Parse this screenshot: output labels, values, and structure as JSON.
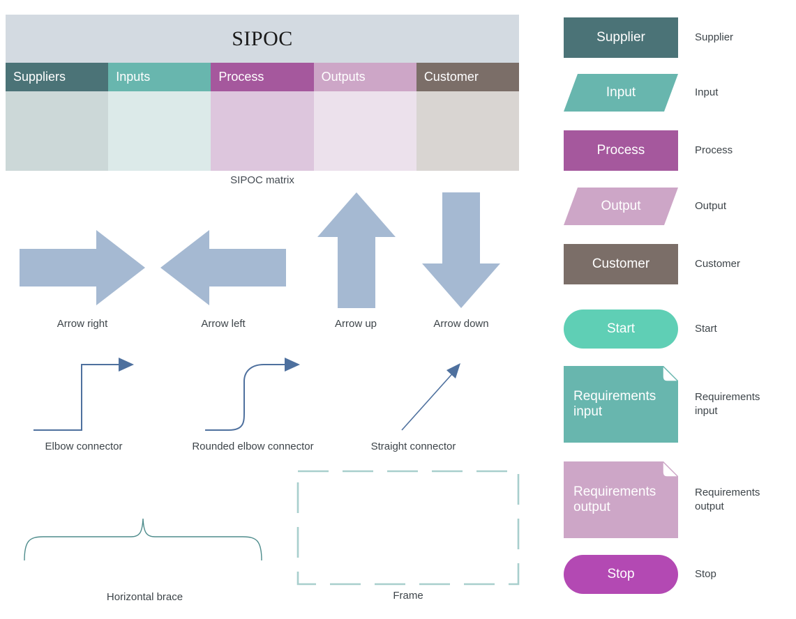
{
  "sipoc": {
    "title": "SIPOC",
    "caption": "SIPOC matrix",
    "title_band_color": "#d3dae1",
    "columns": [
      {
        "header": "Suppliers",
        "header_color": "#4b7377",
        "body_color": "#ccd8d8"
      },
      {
        "header": "Inputs",
        "header_color": "#68b6ae",
        "body_color": "#dceae9"
      },
      {
        "header": "Process",
        "header_color": "#a5589d",
        "body_color": "#ddc6dd"
      },
      {
        "header": "Outputs",
        "header_color": "#cda6c7",
        "body_color": "#ece1ec"
      },
      {
        "header": "Customer",
        "header_color": "#7b6e68",
        "body_color": "#d9d5d2"
      }
    ]
  },
  "shapes": {
    "arrow_fill": "#a5b9d2",
    "connector_stroke": "#4e709e",
    "brace_stroke": "#4e8c8c",
    "frame_stroke": "#a8cfcd",
    "arrow_right": "Arrow right",
    "arrow_left": "Arrow left",
    "arrow_up": "Arrow up",
    "arrow_down": "Arrow down",
    "elbow_connector": "Elbow connector",
    "rounded_elbow_connector": "Rounded elbow connector",
    "straight_connector": "Straight connector",
    "horizontal_brace": "Horizontal brace",
    "frame": "Frame"
  },
  "legend": {
    "items": [
      {
        "shape_text": "Supplier",
        "caption": "Supplier",
        "color": "#4b7377",
        "kind": "rect"
      },
      {
        "shape_text": "Input",
        "caption": "Input",
        "color": "#68b6ae",
        "kind": "parallelogram"
      },
      {
        "shape_text": "Process",
        "caption": "Process",
        "color": "#a5589d",
        "kind": "rect"
      },
      {
        "shape_text": "Output",
        "caption": "Output",
        "color": "#cda6c7",
        "kind": "parallelogram"
      },
      {
        "shape_text": "Customer",
        "caption": "Customer",
        "color": "#7b6e68",
        "kind": "rect"
      },
      {
        "shape_text": "Start",
        "caption": "Start",
        "color": "#5fcfb5",
        "kind": "pill"
      },
      {
        "shape_text": "Requirements\ninput",
        "caption": "Requirements\ninput",
        "color": "#68b6ae",
        "kind": "document"
      },
      {
        "shape_text": "Requirements\noutput",
        "caption": "Requirements\noutput",
        "color": "#cda6c7",
        "kind": "document"
      },
      {
        "shape_text": "Stop",
        "caption": "Stop",
        "color": "#b349b3",
        "kind": "pill"
      }
    ]
  }
}
